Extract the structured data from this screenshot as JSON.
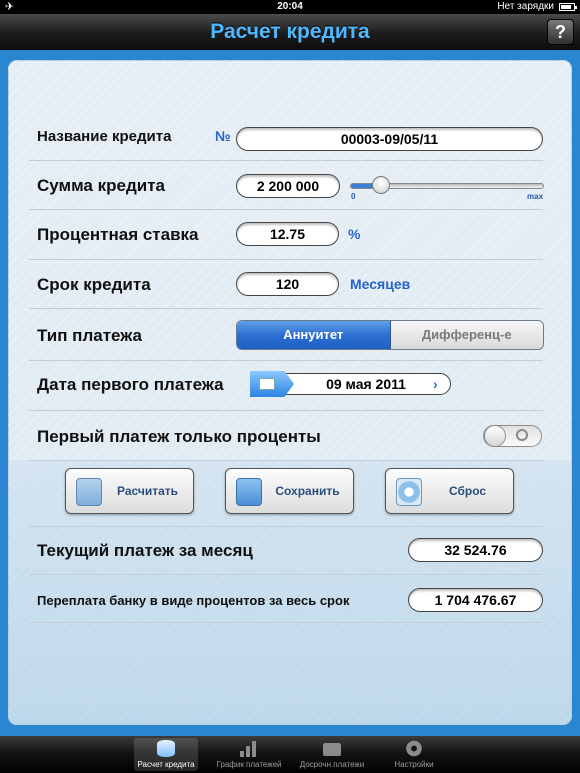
{
  "status_bar": {
    "time": "20:04",
    "charging": "Нет зарядки",
    "airplane_icon": "airplane-icon",
    "battery_icon": "battery-icon"
  },
  "navbar": {
    "title": "Расчет кредита",
    "help_label": "?"
  },
  "form": {
    "loan_name": {
      "label": "Название кредита",
      "prefix": "№",
      "value": "00003-09/05/11"
    },
    "amount": {
      "label": "Сумма кредита",
      "value": "2 200 000",
      "slider_min": "0",
      "slider_max": "max",
      "slider_fraction": 0.12
    },
    "rate": {
      "label": "Процентная ставка",
      "value": "12.75",
      "unit": "%"
    },
    "term": {
      "label": "Срок кредита",
      "value": "120",
      "unit": "Месяцев"
    },
    "payment_type": {
      "label": "Тип платежа",
      "options": [
        "Аннуитет",
        "Дифференц-е"
      ],
      "selected": "Аннуитет"
    },
    "first_date": {
      "label": "Дата первого платежа",
      "value": "09 мая 2011",
      "chevron": "›",
      "icon": "calendar-icon"
    },
    "interest_only": {
      "label": "Первый платеж только проценты",
      "toggle_on": false
    }
  },
  "actions": {
    "calculate": "Расчитать",
    "save": "Сохранить",
    "reset": "Сброс"
  },
  "results": {
    "monthly_payment": {
      "label": "Текущий платеж за месяц",
      "value": "32 524.76"
    },
    "overpayment": {
      "label": "Переплата банку в виде процентов за весь срок",
      "value": "1 704 476.67"
    }
  },
  "tabbar": {
    "items": [
      {
        "label": "Расчет кредита",
        "icon": "database-icon",
        "active": true
      },
      {
        "label": "График платежей",
        "icon": "bar-chart-icon",
        "active": false
      },
      {
        "label": "Досрочн.платежи",
        "icon": "briefcase-icon",
        "active": false
      },
      {
        "label": "Настройки",
        "icon": "gear-icon",
        "active": false
      }
    ]
  },
  "colors": {
    "accent_blue": "#2764c9",
    "title_blue": "#4fb7ff",
    "background_blue": "#2a86d0"
  }
}
